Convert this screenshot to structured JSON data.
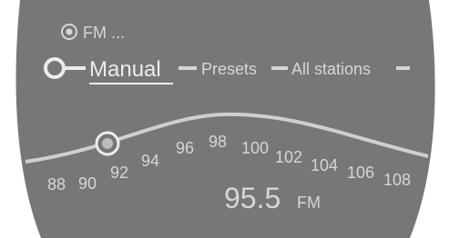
{
  "header": {
    "source_label": "FM ...",
    "source_icon": "radio-source-icon"
  },
  "modes": {
    "selected_icon": "selected-mode-ring-icon",
    "items": [
      {
        "label": "Manual",
        "selected": true
      },
      {
        "label": "Presets",
        "selected": false
      },
      {
        "label": "All stations",
        "selected": false
      }
    ]
  },
  "scale": {
    "marker_icon": "tuning-marker-icon",
    "marker_frequency": 91.5,
    "ticks": [
      "88",
      "90",
      "92",
      "94",
      "96",
      "98",
      "100",
      "102",
      "104",
      "106",
      "108"
    ]
  },
  "frequency": {
    "value": "95.5",
    "band": "FM"
  },
  "colors": {
    "panel": "#777777",
    "text": "#d6d6d6",
    "curve": "#cfcfcf",
    "accent": "#ececec"
  }
}
